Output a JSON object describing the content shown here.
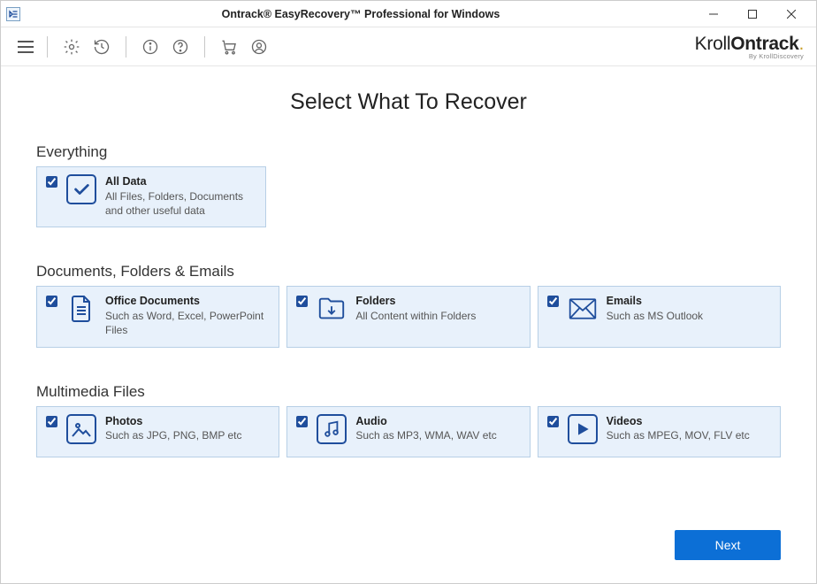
{
  "window": {
    "title": "Ontrack® EasyRecovery™ Professional for Windows"
  },
  "brand": {
    "left": "Kroll",
    "right": "Ontrack",
    "sub": "By KrollDiscovery"
  },
  "page": {
    "heading": "Select What To Recover"
  },
  "sections": {
    "everything": {
      "label": "Everything",
      "card": {
        "title": "All Data",
        "desc": "All Files, Folders, Documents and other useful data"
      }
    },
    "docs": {
      "label": "Documents, Folders & Emails",
      "office": {
        "title": "Office Documents",
        "desc": "Such as Word, Excel, PowerPoint Files"
      },
      "folders": {
        "title": "Folders",
        "desc": "All Content within Folders"
      },
      "emails": {
        "title": "Emails",
        "desc": "Such as MS Outlook"
      }
    },
    "media": {
      "label": "Multimedia Files",
      "photos": {
        "title": "Photos",
        "desc": "Such as JPG, PNG, BMP etc"
      },
      "audio": {
        "title": "Audio",
        "desc": "Such as MP3, WMA, WAV etc"
      },
      "videos": {
        "title": "Videos",
        "desc": "Such as MPEG, MOV, FLV etc"
      }
    }
  },
  "footer": {
    "next": "Next"
  }
}
